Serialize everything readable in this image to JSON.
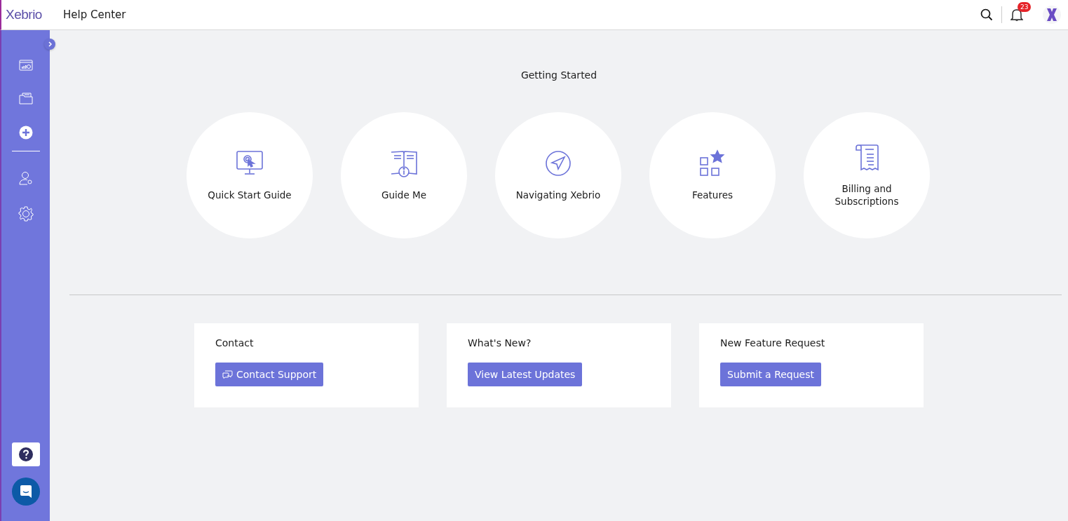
{
  "header": {
    "logo": "Xebrio",
    "title": "Help Center",
    "notification_count": "23"
  },
  "section_title": "Getting Started",
  "topics": [
    {
      "label": "Quick Start Guide",
      "kind": "monitor"
    },
    {
      "label": "Guide Me",
      "kind": "book"
    },
    {
      "label": "Navigating Xebrio",
      "kind": "compass"
    },
    {
      "label": "Features",
      "kind": "grid"
    },
    {
      "label": "Billing and Subscriptions",
      "kind": "receipt"
    }
  ],
  "cards": [
    {
      "title": "Contact",
      "button": "Contact Support",
      "icon": true
    },
    {
      "title": "What's New?",
      "button": "View Latest Updates",
      "icon": false
    },
    {
      "title": "New Feature Request",
      "button": "Submit a Request",
      "icon": false
    }
  ]
}
